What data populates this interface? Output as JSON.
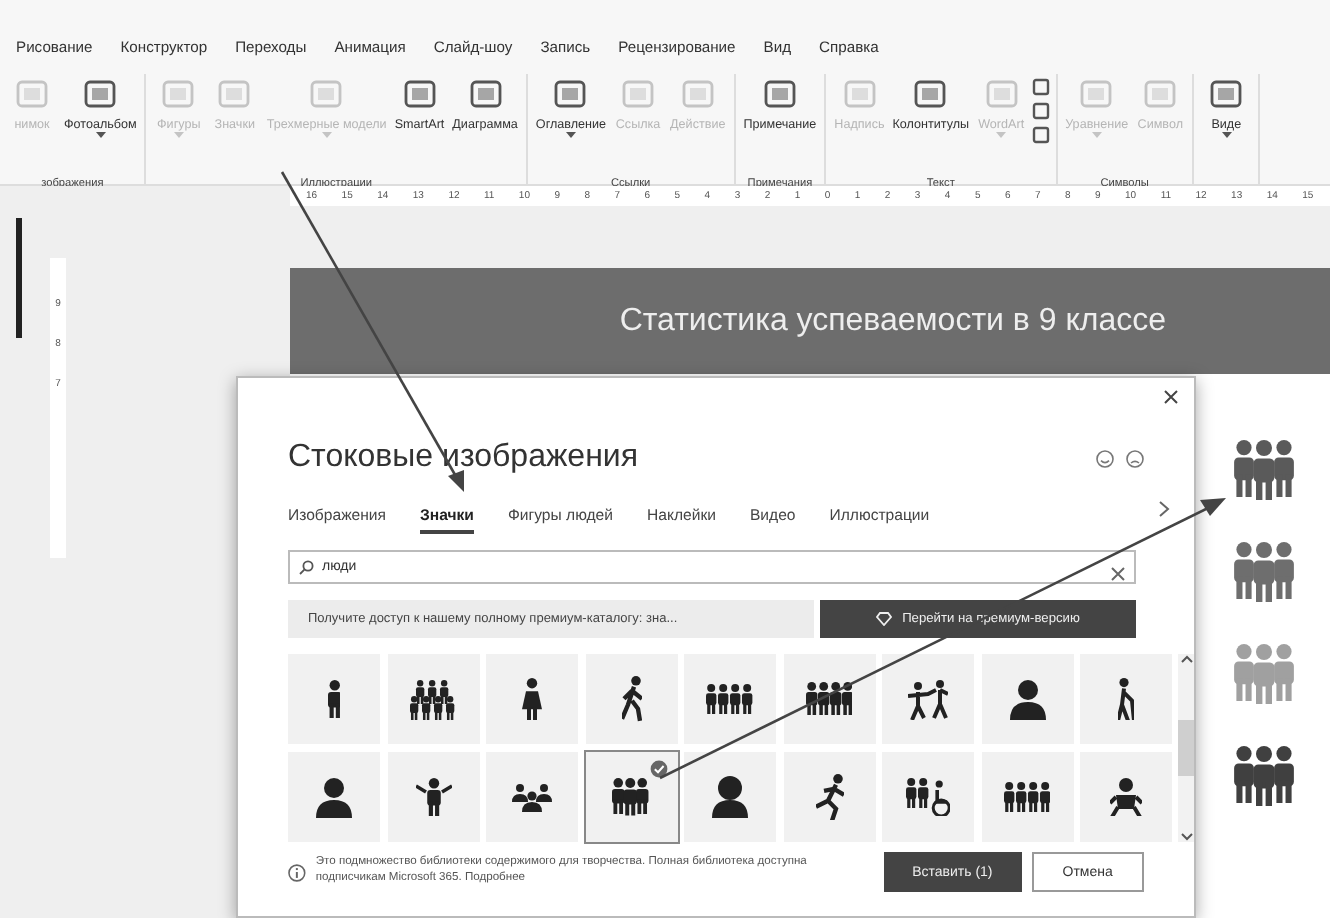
{
  "ribbon": {
    "tabs": [
      {
        "label": "Рисование",
        "selected": false
      },
      {
        "label": "Конструктор",
        "selected": false
      },
      {
        "label": "Переходы",
        "selected": false
      },
      {
        "label": "Анимация",
        "selected": false
      },
      {
        "label": "Слайд-шоу",
        "selected": false
      },
      {
        "label": "Запись",
        "selected": false
      },
      {
        "label": "Рецензирование",
        "selected": false
      },
      {
        "label": "Вид",
        "selected": false
      },
      {
        "label": "Справка",
        "selected": false
      }
    ],
    "groups": [
      {
        "label": "зображения",
        "buttons": [
          {
            "kind": "large",
            "label": "нимок",
            "disabled": true,
            "dropdown": false
          },
          {
            "kind": "large",
            "label": "Фотоальбом",
            "disabled": false,
            "dropdown": true
          }
        ]
      },
      {
        "label": "Иллюстрации",
        "buttons": [
          {
            "kind": "large",
            "label": "Фигуры",
            "disabled": true,
            "dropdown": true
          },
          {
            "kind": "large",
            "label": "Значки",
            "disabled": true,
            "dropdown": false
          },
          {
            "kind": "large",
            "label": "Трехмерные модели",
            "disabled": true,
            "dropdown": true
          },
          {
            "kind": "large",
            "label": "SmartArt",
            "disabled": false,
            "dropdown": false
          },
          {
            "kind": "large",
            "label": "Диаграмма",
            "disabled": false,
            "dropdown": false
          }
        ]
      },
      {
        "label": "Ссылки",
        "buttons": [
          {
            "kind": "large",
            "label": "Оглавление",
            "disabled": false,
            "dropdown": true
          },
          {
            "kind": "large",
            "label": "Ссылка",
            "disabled": true,
            "dropdown": false
          },
          {
            "kind": "large",
            "label": "Действие",
            "disabled": true,
            "dropdown": false
          }
        ]
      },
      {
        "label": "Примечания",
        "buttons": [
          {
            "kind": "large",
            "label": "Примечание",
            "disabled": false,
            "dropdown": false
          }
        ]
      },
      {
        "label": "Текст",
        "buttons": [
          {
            "kind": "large",
            "label": "Надпись",
            "disabled": true,
            "dropdown": false
          },
          {
            "kind": "large",
            "label": "Колонтитулы",
            "disabled": false,
            "dropdown": false
          },
          {
            "kind": "large",
            "label": "WordArt",
            "disabled": true,
            "dropdown": true
          },
          {
            "kind": "stack"
          }
        ]
      },
      {
        "label": "Символы",
        "buttons": [
          {
            "kind": "large",
            "label": "Уравнение",
            "disabled": true,
            "dropdown": true
          },
          {
            "kind": "large",
            "label": "Символ",
            "disabled": true,
            "dropdown": false
          }
        ]
      },
      {
        "buttons": [
          {
            "kind": "large",
            "label": "Виде",
            "disabled": false,
            "dropdown": true
          }
        ]
      }
    ]
  },
  "rulers": {
    "horizontal": [
      "16",
      "15",
      "14",
      "13",
      "12",
      "11",
      "10",
      "9",
      "8",
      "7",
      "6",
      "5",
      "4",
      "3",
      "2",
      "1",
      "0",
      "1",
      "2",
      "3",
      "4",
      "5",
      "6",
      "7",
      "8",
      "9",
      "10",
      "11",
      "12",
      "13",
      "14",
      "15"
    ],
    "vertical": [
      "9",
      "8",
      "7"
    ]
  },
  "slide": {
    "title": "Статистика успеваемости в 9 классе",
    "pictograms": [
      {
        "color": "#5a5a5a"
      },
      {
        "color": "#6e6e6e"
      },
      {
        "color": "#a0a0a0"
      },
      {
        "color": "#404040"
      }
    ]
  },
  "dialog": {
    "title": "Стоковые изображения",
    "tabs": [
      {
        "label": "Изображения",
        "selected": false
      },
      {
        "label": "Значки",
        "selected": true
      },
      {
        "label": "Фигуры людей",
        "selected": false
      },
      {
        "label": "Наклейки",
        "selected": false
      },
      {
        "label": "Видео",
        "selected": false
      },
      {
        "label": "Иллюстрации",
        "selected": false
      }
    ],
    "search": {
      "value": "люди"
    },
    "promo": {
      "text": "Получите доступ к нашему полному премиум-каталогу: зна...",
      "button": "Перейти на премиум-версию"
    },
    "icons": [
      {
        "selected": false
      },
      {
        "selected": false
      },
      {
        "selected": false
      },
      {
        "selected": false
      },
      {
        "selected": false
      },
      {
        "selected": false
      },
      {
        "selected": false
      },
      {
        "selected": false
      },
      {
        "selected": false
      },
      {
        "selected": false
      },
      {
        "selected": false
      },
      {
        "selected": false
      },
      {
        "selected": true
      },
      {
        "selected": false
      },
      {
        "selected": false
      },
      {
        "selected": false
      },
      {
        "selected": false
      },
      {
        "selected": false
      }
    ],
    "note": "Это подмножество библиотеки содержимого для творчества. Полная библиотека доступна подписчикам Microsoft 365.",
    "note_link": "Подробнее",
    "insert_button": "Вставить (1)",
    "cancel_button": "Отмена"
  }
}
